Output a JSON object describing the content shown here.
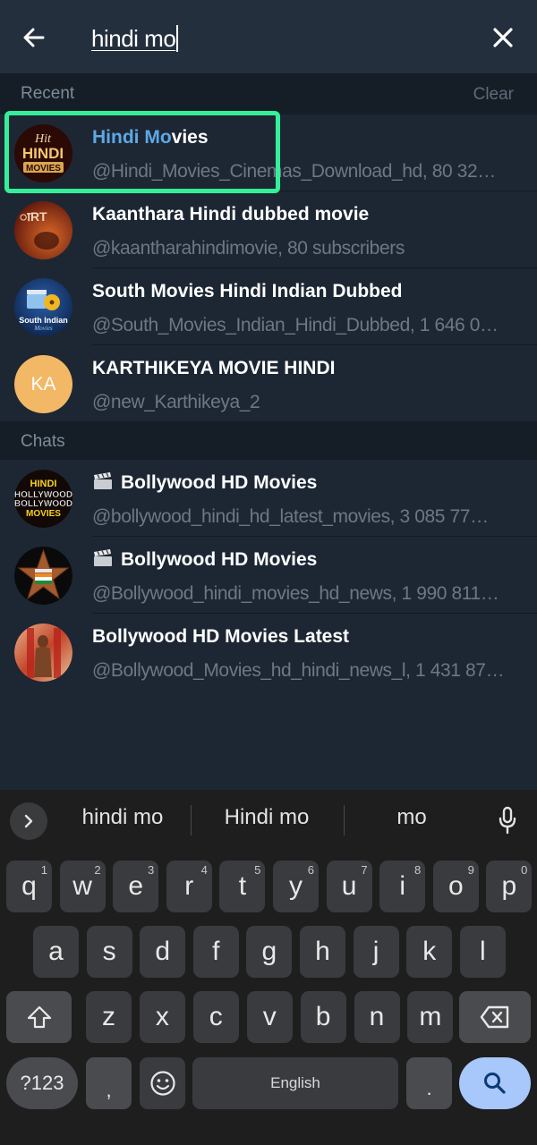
{
  "search": {
    "query": "hindi mo",
    "back_icon": "arrow-left-icon",
    "close_icon": "close-icon"
  },
  "recent": {
    "title": "Recent",
    "clear_label": "Clear",
    "items": [
      {
        "title_highlight": "Hindi Mo",
        "title_rest": "vies",
        "subtitle": "@Hindi_Movies_Cinemas_Download_hd, 80 32…",
        "avatar": "hit-hindi-movies-avatar",
        "highlighted": true
      },
      {
        "title": "Kaanthara Hindi dubbed movie",
        "subtitle": "@kaantharahindimovie, 80 subscribers",
        "avatar": "kaanthara-poster-avatar"
      },
      {
        "title": "South Movies Hindi Indian Dubbed",
        "subtitle": "@South_Movies_Indian_Hindi_Dubbed, 1 646 0…",
        "avatar": "south-indian-movies-avatar"
      },
      {
        "title": "KARTHIKEYA MOVIE HINDI",
        "subtitle": "@new_Karthikeya_2",
        "avatar_initials": "KA",
        "avatar_color": "#f2b866"
      }
    ]
  },
  "chats": {
    "title": "Chats",
    "items": [
      {
        "emoji": "🎬",
        "title": "Bollywood HD Movies",
        "subtitle": "@bollywood_hindi_hd_latest_movies, 3 085 77…",
        "avatar": "hindi-hollywood-bollywood-movies-avatar"
      },
      {
        "emoji": "🎬",
        "title": "Bollywood HD Movies",
        "subtitle": "@Bollywood_hindi_movies_hd_news, 1 990 811…",
        "avatar": "star-india-flag-avatar"
      },
      {
        "title": "Bollywood HD Movies Latest",
        "subtitle": "@Bollywood_Movies_hd_hindi_news_l, 1 431 87…",
        "avatar": "movie-hero-poster-avatar"
      }
    ]
  },
  "keyboard": {
    "suggestions": [
      "hindi mo",
      "Hindi mo",
      "mo"
    ],
    "row1": [
      {
        "k": "q",
        "h": "1"
      },
      {
        "k": "w",
        "h": "2"
      },
      {
        "k": "e",
        "h": "3"
      },
      {
        "k": "r",
        "h": "4"
      },
      {
        "k": "t",
        "h": "5"
      },
      {
        "k": "y",
        "h": "6"
      },
      {
        "k": "u",
        "h": "7"
      },
      {
        "k": "i",
        "h": "8"
      },
      {
        "k": "o",
        "h": "9"
      },
      {
        "k": "p",
        "h": "0"
      }
    ],
    "row2": [
      "a",
      "s",
      "d",
      "f",
      "g",
      "h",
      "j",
      "k",
      "l"
    ],
    "row3": [
      "z",
      "x",
      "c",
      "v",
      "b",
      "n",
      "m"
    ],
    "symbols_label": "?123",
    "comma_label": ",",
    "space_label": "English",
    "period_label": ".",
    "accent_color": "#a8c7fa"
  },
  "colors": {
    "highlight_border": "#35ef98",
    "match_highlight": "#5ea8e6"
  }
}
